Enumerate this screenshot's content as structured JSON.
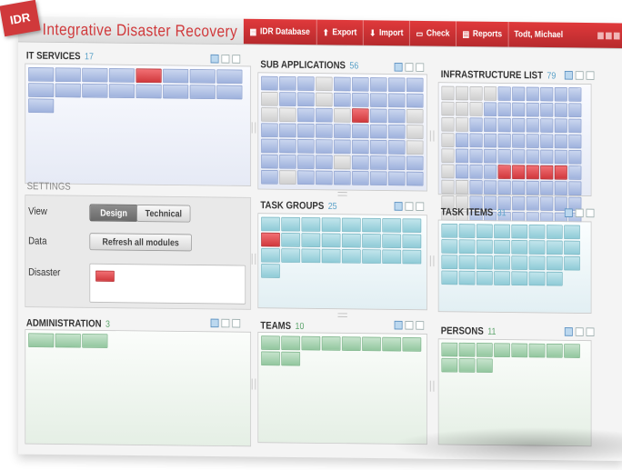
{
  "logo": {
    "text": "IDR"
  },
  "brand": {
    "title": "Integrative Disaster Recovery"
  },
  "menu": [
    {
      "label": "IDR Database",
      "icon": "database-icon",
      "glyph": "▦"
    },
    {
      "label": "Export",
      "icon": "export-icon",
      "glyph": "⬆"
    },
    {
      "label": "Import",
      "icon": "import-icon",
      "glyph": "⬇"
    },
    {
      "label": "Check",
      "icon": "check-icon",
      "glyph": "▭"
    },
    {
      "label": "Reports",
      "icon": "reports-icon",
      "glyph": "▤"
    }
  ],
  "user": {
    "name": "Todt, Michael"
  },
  "modules": {
    "it_services": {
      "title": "IT SERVICES",
      "count": "17"
    },
    "sub_applications": {
      "title": "SUB APPLICATIONS",
      "count": "56"
    },
    "infrastructure_list": {
      "title": "INFRASTRUCTURE LIST",
      "count": "79"
    },
    "task_groups": {
      "title": "TASK GROUPS",
      "count": "25"
    },
    "task_items": {
      "title": "TASK ITEMS",
      "count": "31"
    },
    "administration": {
      "title": "ADMINISTRATION",
      "count": "3"
    },
    "teams": {
      "title": "TEAMS",
      "count": "10"
    },
    "persons": {
      "title": "PERSONS",
      "count": "11"
    }
  },
  "settings": {
    "title": "SETTINGS",
    "view_label": "View",
    "view_options": [
      "Design",
      "Technical"
    ],
    "view_selected": "Design",
    "data_label": "Data",
    "refresh_button": "Refresh all modules",
    "disaster_label": "Disaster"
  },
  "colors": {
    "brand_red": "#d0393b",
    "tile_blue": "#a9bbe2",
    "tile_cyan": "#9fd3de",
    "tile_green": "#9fcfa9",
    "tile_alert": "#e04448"
  }
}
